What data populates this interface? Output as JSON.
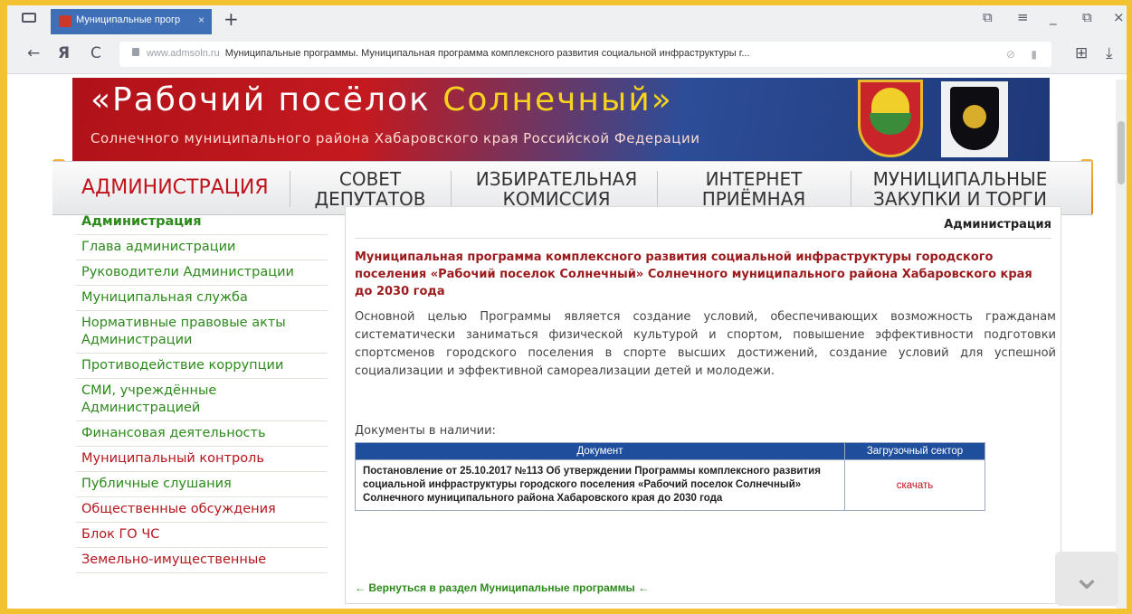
{
  "browser": {
    "tab_title": "Муниципальные прогр",
    "tab_close": "×",
    "new_tab": "+",
    "url_host": "www.admsoln.ru",
    "url_rest": "Муниципальные программы. Муниципальная программа комплексного развития социальной инфраструктуры г...",
    "yandex": "Я",
    "back": "←",
    "reload": "C",
    "controls": [
      "⧉",
      "≡",
      "_",
      "⧉",
      "×"
    ],
    "right_icons": [
      "⊞",
      "⤓"
    ]
  },
  "header": {
    "title_part1": "«Рабочий посёлок ",
    "title_part2": "Солнечный»",
    "subtitle": "Солнечного муниципального района Хабаровского края Российской Федерации"
  },
  "nav": [
    {
      "line1": "АДМИНИСТРАЦИЯ",
      "line2": ""
    },
    {
      "line1": "СОВЕТ",
      "line2": "ДЕПУТАТОВ"
    },
    {
      "line1": "ИЗБИРАТЕЛЬНАЯ",
      "line2": "КОМИССИЯ"
    },
    {
      "line1": "ИНТЕРНЕТ",
      "line2": "ПРИЁМНАЯ"
    },
    {
      "line1": "МУНИЦИПАЛЬНЫЕ",
      "line2": "ЗАКУПКИ И ТОРГИ"
    }
  ],
  "sidebar": {
    "items": [
      "Администрация",
      "Глава администрации",
      "Руководители Администрации",
      "Муниципальная служба",
      "Нормативные правовые акты Администрации",
      "Противодействие коррупции",
      "СМИ, учреждённые Администрацией",
      "Финансовая деятельность",
      "Муниципальный контроль",
      "Публичные слушания",
      "Общественные обсуждения",
      "Блок ГО ЧС",
      "Земельно-имущественные"
    ]
  },
  "content": {
    "section_title": "Администрация",
    "heading": "Муниципальная программа комплексного развития социальной инфраструктуры городского поселения «Рабочий поселок Солнечный» Солнечного муниципального района Хабаровского края до 2030 года",
    "paragraph": "Основной целью Программы является создание условий, обеспечивающих возможность гражданам систематически заниматься физической культурой и спортом, повышение эффективности подготовки спортсменов городского поселения в спорте высших достижений, создание условий для успешной социализации и эффективной самореализации детей и молодежи.",
    "docs_label": "Документы в наличии:",
    "table": {
      "col_doc": "Документ",
      "col_dl": "Загрузочный сектор",
      "rows": [
        {
          "doc": "Постановление от 25.10.2017 №113 Об утверждении Программы комплексного развития социальной инфраструктуры городского поселения «Рабочий поселок Солнечный» Солнечного муниципального района Хабаровского края до 2030 года",
          "dl": "скачать"
        }
      ]
    },
    "back_link": "← Вернуться в раздел Муниципальные программы ←"
  }
}
